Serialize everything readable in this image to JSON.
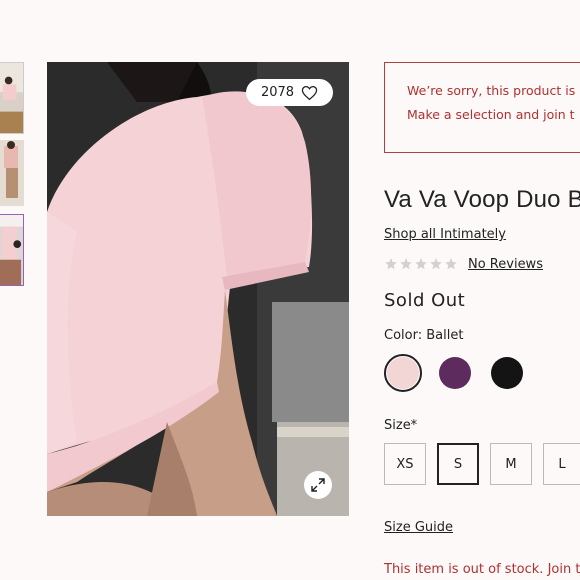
{
  "gallery": {
    "thumbnails": [
      {
        "label": "thumbnail-1"
      },
      {
        "label": "thumbnail-2"
      },
      {
        "label": "thumbnail-3",
        "selected": true
      }
    ],
    "like_count": "2078",
    "icons": {
      "like": "heart-icon",
      "expand": "expand-icon"
    }
  },
  "alert": {
    "line1": "We’re sorry, this product is",
    "line2": "Make a selection and join t"
  },
  "product": {
    "title": "Va Va Voop Duo Bo",
    "shop_link": "Shop all Intimately",
    "rating_stars": 0,
    "reviews_link": "No Reviews",
    "status": "Sold Out",
    "color_label": "Color: Ballet",
    "colors": [
      {
        "name": "Ballet",
        "hex": "#f2d6d6",
        "selected": true
      },
      {
        "name": "Purple",
        "hex": "#5e2b5e"
      },
      {
        "name": "Black",
        "hex": "#141414"
      }
    ],
    "size_label": "Size*",
    "sizes": [
      {
        "label": "XS"
      },
      {
        "label": "S",
        "selected": true
      },
      {
        "label": "M"
      },
      {
        "label": "L"
      }
    ],
    "size_guide": "Size Guide",
    "out_of_stock": "This item is out of stock. Join t"
  },
  "colors": {
    "alert": "#b03030",
    "selected_border": "#222222",
    "thumb_selected_border": "#9b5fb5"
  }
}
